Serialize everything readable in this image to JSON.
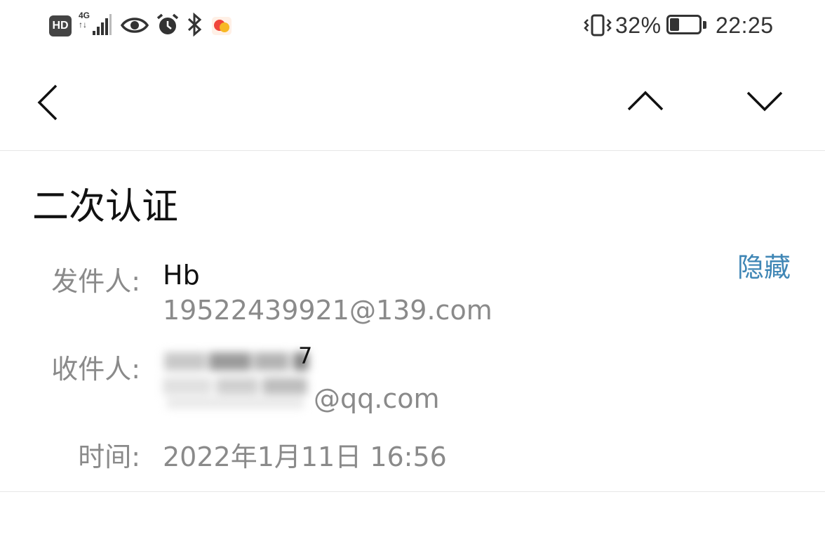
{
  "status_bar": {
    "hd_badge": "HD",
    "network_label_top": "4G",
    "network_label_bottom": "↑↓",
    "battery_percent": "32%",
    "battery_level": 0.32,
    "time": "22:25"
  },
  "toolbar": {
    "back_icon": "chevron-left-icon",
    "prev_icon": "chevron-up-icon",
    "next_icon": "chevron-down-icon"
  },
  "email": {
    "subject": "二次认证",
    "hide_label": "隐藏",
    "sender_label": "发件人:",
    "sender_name": "Hb",
    "sender_address": "19522439921@139.com",
    "recipient_label": "收件人:",
    "recipient_name_visible": "7",
    "recipient_address_visible": "@qq.com",
    "time_label": "时间:",
    "time_value": "2022年1月11日 16:56"
  }
}
